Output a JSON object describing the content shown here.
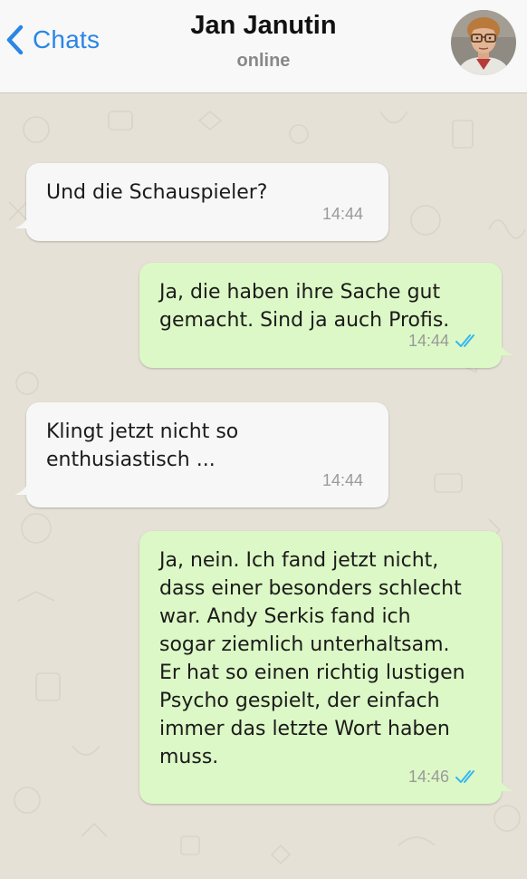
{
  "header": {
    "back_label": "Chats",
    "contact_name": "Jan Janutin",
    "status": "online"
  },
  "colors": {
    "accent": "#2a86e6",
    "incoming_bubble": "#f7f7f7",
    "outgoing_bubble": "#dcf8c6",
    "read_ticks": "#34b7f1",
    "chat_background": "#e6e1d6"
  },
  "messages": [
    {
      "direction": "incoming",
      "text": "Und die Schauspieler?",
      "time": "14:44"
    },
    {
      "direction": "outgoing",
      "text": "Ja, die haben ihre Sache gut\ngemacht. Sind ja auch Profis.",
      "time": "14:44",
      "status_icon": "double-check-icon"
    },
    {
      "direction": "incoming",
      "text": "Klingt jetzt nicht so\nenthusiastisch ...",
      "time": "14:44"
    },
    {
      "direction": "outgoing",
      "text": "Ja, nein. Ich fand jetzt nicht,\ndass einer besonders schlecht\nwar. Andy Serkis fand ich\nsogar ziemlich unterhaltsam.\nEr hat so einen richtig lustigen\nPsycho gespielt, der einfach\nimmer das letzte Wort haben\nmuss.",
      "time": "14:46",
      "status_icon": "double-check-icon"
    }
  ]
}
